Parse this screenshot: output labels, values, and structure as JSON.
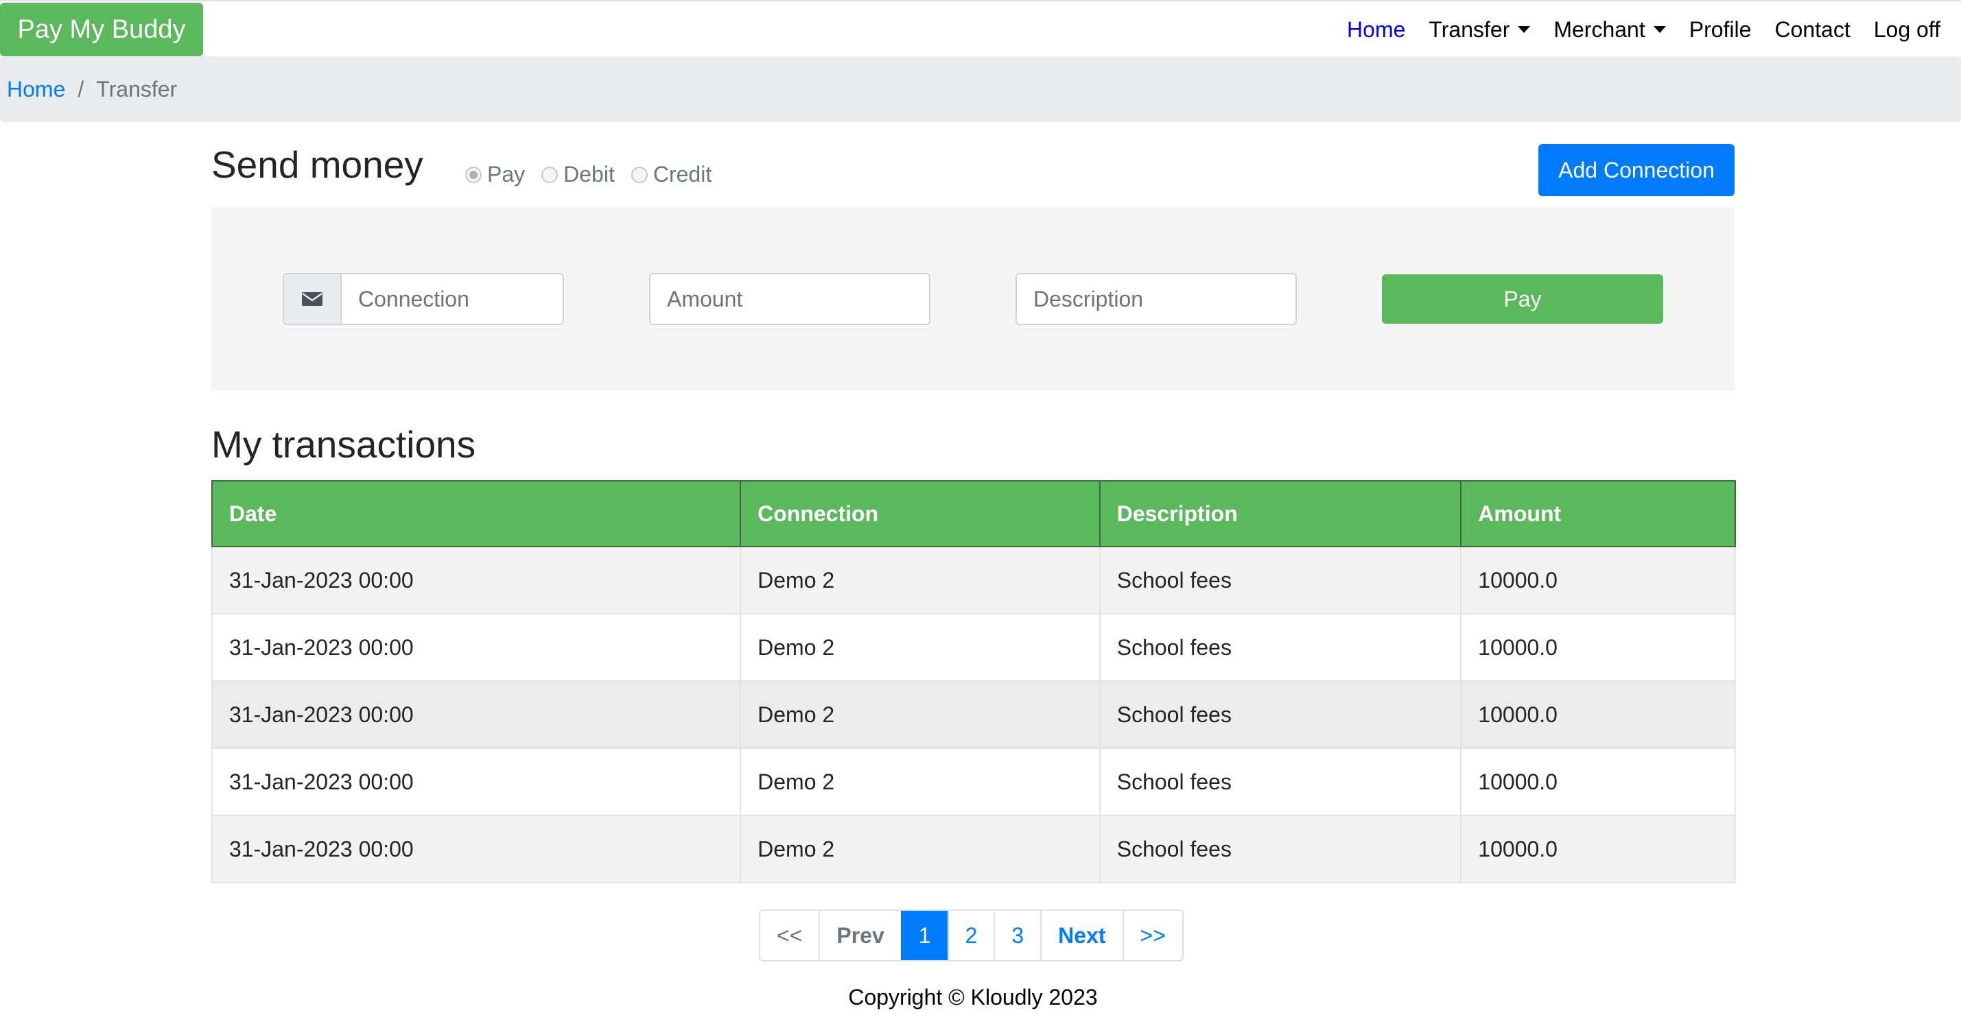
{
  "navbar": {
    "brand": "Pay My Buddy",
    "items": [
      {
        "label": "Home",
        "active": true,
        "dropdown": false
      },
      {
        "label": "Transfer",
        "active": false,
        "dropdown": true
      },
      {
        "label": "Merchant",
        "active": false,
        "dropdown": true
      },
      {
        "label": "Profile",
        "active": false,
        "dropdown": false
      },
      {
        "label": "Contact",
        "active": false,
        "dropdown": false
      },
      {
        "label": "Log off",
        "active": false,
        "dropdown": false
      }
    ]
  },
  "breadcrumb": {
    "home": "Home",
    "separator": "/",
    "current": "Transfer"
  },
  "send_money": {
    "title": "Send money",
    "radios": [
      {
        "label": "Pay",
        "checked": true
      },
      {
        "label": "Debit",
        "checked": false
      },
      {
        "label": "Credit",
        "checked": false
      }
    ],
    "add_connection_label": "Add Connection",
    "connection_placeholder": "Connection",
    "amount_placeholder": "Amount",
    "description_placeholder": "Description",
    "pay_label": "Pay"
  },
  "transactions": {
    "title": "My transactions",
    "columns": [
      "Date",
      "Connection",
      "Description",
      "Amount"
    ],
    "rows": [
      [
        "31-Jan-2023 00:00",
        "Demo 2",
        "School fees",
        "10000.0"
      ],
      [
        "31-Jan-2023 00:00",
        "Demo 2",
        "School fees",
        "10000.0"
      ],
      [
        "31-Jan-2023 00:00",
        "Demo 2",
        "School fees",
        "10000.0"
      ],
      [
        "31-Jan-2023 00:00",
        "Demo 2",
        "School fees",
        "10000.0"
      ],
      [
        "31-Jan-2023 00:00",
        "Demo 2",
        "School fees",
        "10000.0"
      ]
    ]
  },
  "pagination": {
    "first": "<<",
    "prev": "Prev",
    "pages": [
      "1",
      "2",
      "3"
    ],
    "current": "1",
    "next": "Next",
    "last": ">>"
  },
  "footer": {
    "copyright": "Copyright © Kloudly 2023"
  },
  "colors": {
    "brand_green": "#5cb85c",
    "primary_blue": "#007bff",
    "breadcrumb_bg": "#e9ecef"
  }
}
